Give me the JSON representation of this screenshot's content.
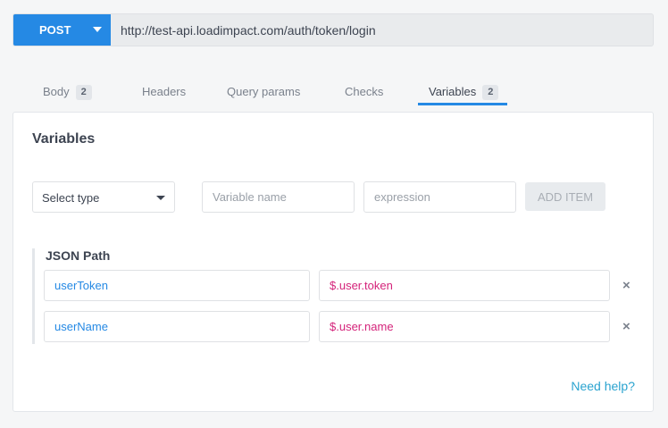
{
  "request": {
    "method": "POST",
    "url": "http://test-api.loadimpact.com/auth/token/login"
  },
  "tabs": [
    {
      "label": "Body",
      "badge": "2"
    },
    {
      "label": "Headers"
    },
    {
      "label": "Query params"
    },
    {
      "label": "Checks"
    },
    {
      "label": "Variables",
      "badge": "2",
      "active": true
    }
  ],
  "panel": {
    "title": "Variables",
    "select_type": "Select type",
    "variable_name_placeholder": "Variable name",
    "expression_placeholder": "expression",
    "add_item_label": "ADD ITEM",
    "group_title": "JSON Path",
    "rows": [
      {
        "name": "userToken",
        "expression": "$.user.token",
        "remove": "×"
      },
      {
        "name": "userName",
        "expression": "$.user.name",
        "remove": "×"
      }
    ],
    "help_link": "Need help?"
  },
  "colors": {
    "accent": "#2589e4",
    "expression": "#d4237a",
    "help_link": "#2aa3cf"
  },
  "icons": {
    "method_dropdown": "chevron-down-icon",
    "select_dropdown": "chevron-down-icon",
    "remove": "close-icon"
  }
}
